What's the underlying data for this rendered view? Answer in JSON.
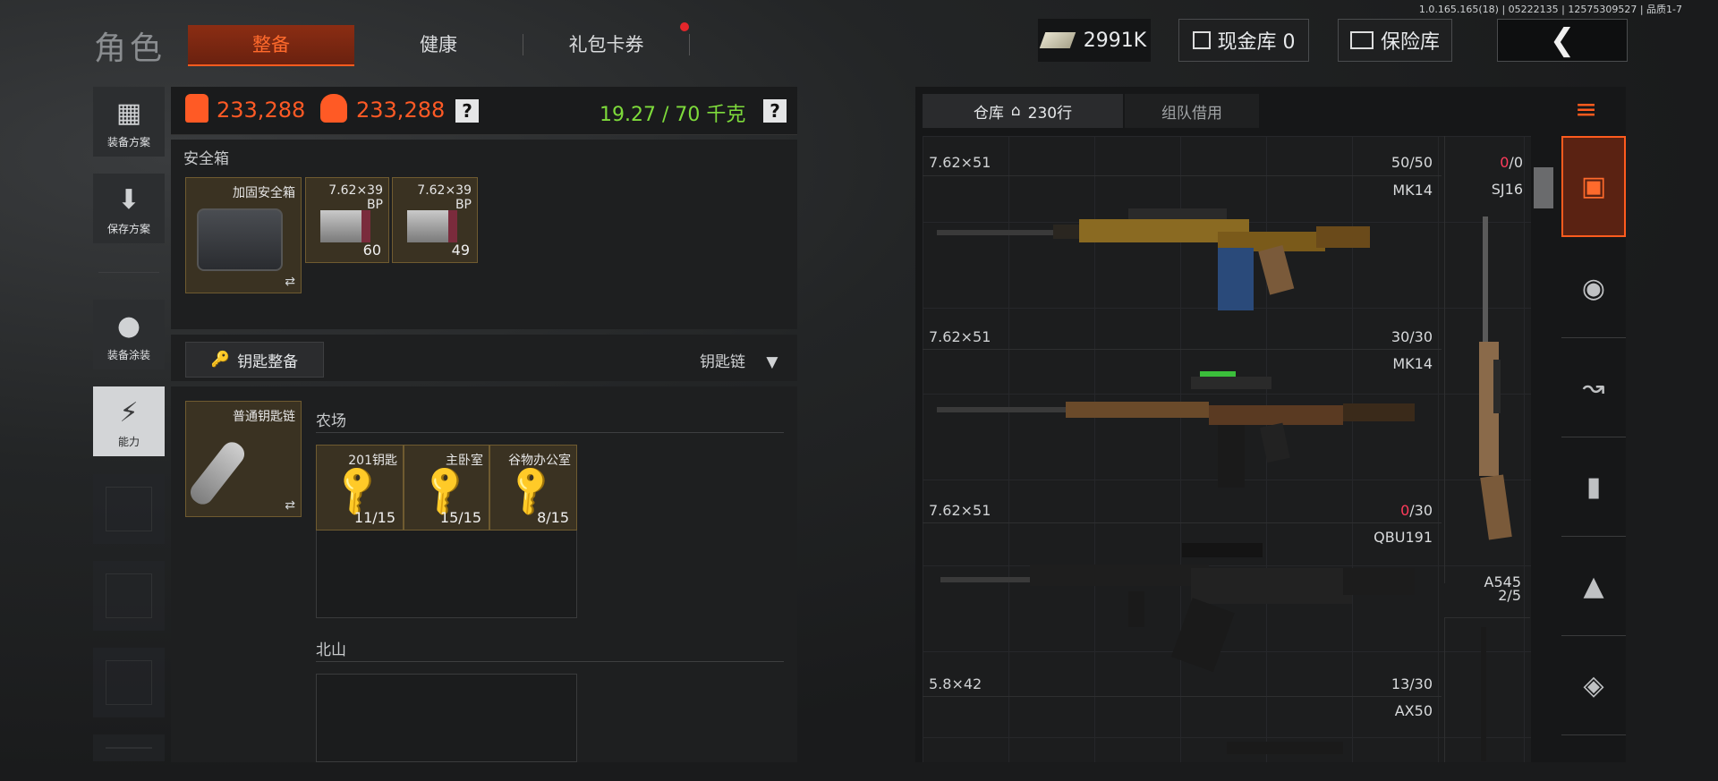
{
  "header": {
    "title": "角色",
    "tabs": [
      {
        "label": "整备"
      },
      {
        "label": "健康"
      },
      {
        "label": "礼包卡券"
      }
    ],
    "version": "1.0.165.165(18) | 05222135 | 12575309527 | 品质1-7",
    "money": "2991K",
    "cash_vault": "现金库 0",
    "safe_vault": "保险库"
  },
  "sidebar": {
    "items": [
      {
        "label": "装备方案"
      },
      {
        "label": "保存方案"
      },
      {
        "label": "装备涂装"
      },
      {
        "label": "能力"
      }
    ]
  },
  "stats": {
    "value1": "233,288",
    "value2": "233,288",
    "help": "?",
    "weight": "19.27 / 70 千克"
  },
  "safebox": {
    "section_label": "安全箱",
    "container_name": "加固安全箱",
    "items": [
      {
        "label": "7.62×39\nBP",
        "count": "60"
      },
      {
        "label": "7.62×39\nBP",
        "count": "49"
      }
    ]
  },
  "keys": {
    "button_label": "钥匙整备",
    "dropdown_label": "钥匙链",
    "keychain_name": "普通钥匙链",
    "farm_label": "农场",
    "farm_keys": [
      {
        "label": "201钥匙",
        "count": "11/15"
      },
      {
        "label": "主卧室",
        "count": "15/15"
      },
      {
        "label": "谷物办公室",
        "count": "8/15"
      }
    ],
    "north_label": "北山"
  },
  "warehouse": {
    "tab_label": "仓库",
    "rows": "230行",
    "tab2_label": "组队借用",
    "weapons": [
      {
        "caliber": "7.62×51",
        "ammo": "50/50",
        "name": "MK14"
      },
      {
        "caliber": "7.62×51",
        "ammo": "30/30",
        "name": "MK14"
      },
      {
        "caliber": "7.62×51",
        "ammo_red": "0",
        "ammo_rest": "/30",
        "name": "QBU191"
      },
      {
        "caliber": "5.8×42",
        "ammo": "13/30",
        "name": "AX50"
      }
    ],
    "side_weapons": [
      {
        "name": "SJ16",
        "ammo_red": "0",
        "ammo_rest": "/0"
      },
      {
        "name": "A545",
        "ammo": "2/5"
      }
    ]
  },
  "colors": {
    "accent": "#ff5b1e",
    "weight_green": "#7edb3b",
    "alert_red": "#ff3b5b"
  }
}
